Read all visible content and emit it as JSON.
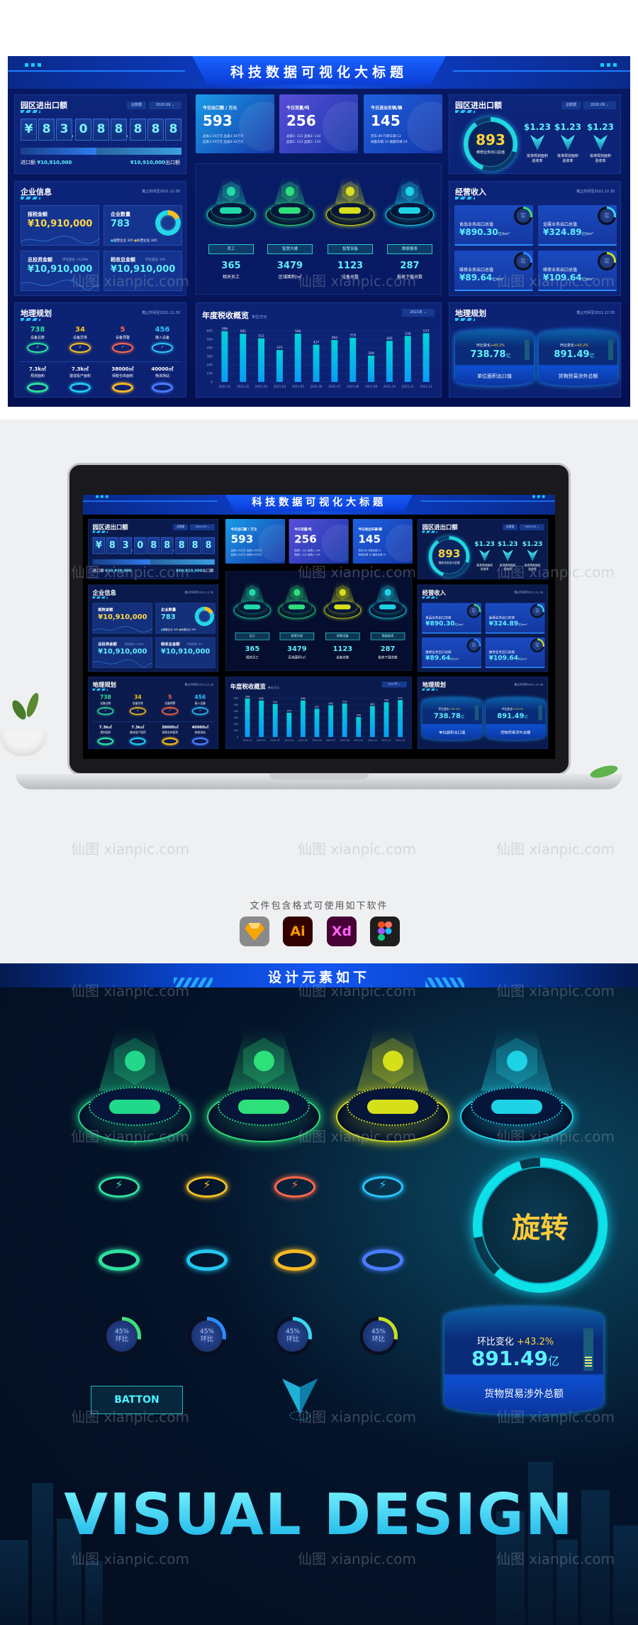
{
  "dashboard": {
    "title": "科技数据可视化大标题",
    "left_trade": {
      "title": "园区进出口额",
      "filter": "总数据",
      "date": "2020.09",
      "digits": [
        "¥",
        "8",
        "3",
        ",",
        "0",
        "8",
        "8",
        ",",
        "8",
        "8",
        "8"
      ],
      "progress": 0.47,
      "import_label": "进口额",
      "import_value": "¥10,910,000",
      "export_value": "¥10,910,000",
      "export_label": "出口额"
    },
    "enterprise": {
      "title": "企业信息",
      "as_of": "截止时间至2021.12.30",
      "tax_label": "报税金额",
      "tax_value": "¥10,910,000",
      "count_label": "企业数量",
      "count_value": "783",
      "state_legend": "国营企业 345",
      "private_legend": "私营企业 345",
      "invest_label": "总投资金额",
      "invest_change": "环比变化 +123%",
      "invest_value": "¥10,910,000",
      "taxrev_label": "税收总金额",
      "taxrev_change": "环比变化 -4%",
      "taxrev_value": "¥10,910,000"
    },
    "geo_left": {
      "title": "地理规划",
      "as_of": "截止时间至2021.12.30",
      "stats": [
        {
          "value": "738",
          "label": "设备总数",
          "color": "#2fe0a0"
        },
        {
          "value": "34",
          "label": "设备异常",
          "color": "#f5c023"
        },
        {
          "value": "5",
          "label": "设备预警",
          "color": "#ff6a4a"
        },
        {
          "value": "456",
          "label": "接入设备",
          "color": "#2bc6ff"
        }
      ],
      "areas": [
        {
          "value": "7.3k㎡",
          "label": "规划面积",
          "color": "#2fe0a0"
        },
        {
          "value": "7.3k㎡",
          "label": "建成投产面积",
          "color": "#22c8f0"
        },
        {
          "value": "38000㎡",
          "label": "保税仓库面积",
          "color": "#f5b923"
        },
        {
          "value": "40000㎡",
          "label": "物流场站",
          "color": "#4a7dff"
        }
      ]
    },
    "cards": [
      {
        "title": "今日出口额 / 万元",
        "value": "593",
        "line1": "品类1:34万元   品类2:34万元",
        "line2": "品类3:34万元   品类4:34万元",
        "color": "#1a9be8"
      },
      {
        "title": "今日货量/吨",
        "value": "256",
        "line1": "品类1: 123   品类2: 134",
        "line2": "品类1: 123   品类2: 134",
        "color": "#5a4fd8"
      },
      {
        "title": "今日进出车辆/辆",
        "value": "145",
        "line1": "货车:89   行政车辆:12",
        "line2": "执勤车辆 10   备勤车辆 24",
        "color": "#1f62e0"
      }
    ],
    "pedestals": [
      {
        "button": "员工",
        "value": "365",
        "label": "相关员工",
        "color": "#22d8a8"
      },
      {
        "button": "智慧大楼",
        "value": "3479",
        "label": "区域面积/㎡",
        "color": "#2ee07a"
      },
      {
        "button": "智慧设备",
        "value": "1123",
        "label": "设备总数",
        "color": "#d6e01a"
      },
      {
        "button": "数据报表",
        "value": "287",
        "label": "报表下载总数",
        "color": "#1ed2e6"
      }
    ],
    "chart_panel": {
      "title": "年度税收概览",
      "unit": "单位/万元",
      "year": "2021年"
    },
    "right_trade": {
      "title": "园区进出口额",
      "filter": "总数据",
      "date": "2020.09",
      "ring_value": "893",
      "ring_label": "维修业务出口总值",
      "items": [
        {
          "value": "$1.23",
          "label": "批准规划面积验收率"
        },
        {
          "value": "$1.23",
          "label": "批准规划面积验收率"
        },
        {
          "value": "$1.23",
          "label": "批准规划面积验收率"
        }
      ]
    },
    "revenue": {
      "title": "经营收入",
      "as_of": "截止时间至2021.12.30",
      "items": [
        {
          "label": "食品业务出口总值",
          "value": "¥890.30",
          "unit": "亿/km²",
          "gauge_value": "45%",
          "gauge_label": "环比",
          "color": "#3ee07a"
        },
        {
          "label": "金属业务出口总值",
          "value": "¥324.89",
          "unit": "亿/km²",
          "gauge_value": "45%",
          "gauge_label": "环比",
          "color": "#3ad8f0"
        },
        {
          "label": "维修业务出口总值",
          "value": "¥89.64",
          "unit": "亿/km²",
          "gauge_value": "45%",
          "gauge_label": "环比",
          "color": "#2a8cff"
        },
        {
          "label": "维修业务出口总值",
          "value": "¥109.64",
          "unit": "亿/km²",
          "gauge_value": "45%",
          "gauge_label": "环比",
          "color": "#c8e020"
        }
      ]
    },
    "geo_right": {
      "title": "地理规划",
      "as_of": "截止时间至2021.12.30",
      "items": [
        {
          "change_label": "环比变化",
          "change": "+43.2%",
          "value": "738.78",
          "unit": "亿",
          "label": "单位面积出口值"
        },
        {
          "change_label": "环比变化",
          "change": "+43.2%",
          "value": "891.49",
          "unit": "亿",
          "label": "货物贸易涉外总额"
        }
      ]
    }
  },
  "chart_data": {
    "type": "bar",
    "title": "年度税收概览",
    "ylabel": "单位/万元",
    "categories": [
      "2021.01",
      "2021.02",
      "2021.03",
      "2021.04",
      "2021.05",
      "2021.06",
      "2021.07",
      "2021.08",
      "2021.09",
      "2021.10",
      "2021.11",
      "2021.12"
    ],
    "values": [
      596,
      565,
      512,
      375,
      566,
      437,
      492,
      519,
      309,
      482,
      539,
      572
    ],
    "yticks": [
      0,
      100,
      200,
      300,
      400,
      500,
      600
    ],
    "ylim": [
      0,
      600
    ],
    "grid": true,
    "data_labels": true,
    "bar_color": [
      "#00d4d8",
      "#0a9cf5"
    ]
  },
  "software": {
    "caption": "文件包含格式可使用如下软件",
    "icons": [
      {
        "name": "sketch-icon",
        "label": ""
      },
      {
        "name": "illustrator-icon",
        "label": "Ai"
      },
      {
        "name": "xd-icon",
        "label": "Xd"
      },
      {
        "name": "figma-icon",
        "label": ""
      }
    ]
  },
  "elements": {
    "title": "设计元素如下",
    "pedestal_colors": [
      "#22d88a",
      "#2ee07a",
      "#d6e01a",
      "#1ed2e6"
    ],
    "ring_colors_row1": [
      "#2fe0a0",
      "#f5c023",
      "#ff6a4a",
      "#2bc6ff"
    ],
    "ring_colors_row2": [
      "#2fe0a0",
      "#22c8f0",
      "#f5b923",
      "#4a7dff"
    ],
    "rotate_label": "旋转",
    "gauges": [
      {
        "value": "45%",
        "label": "环比",
        "color": "#3ee07a"
      },
      {
        "value": "45%",
        "label": "环比",
        "color": "#2a8cff"
      },
      {
        "value": "45%",
        "label": "环比",
        "color": "#3ad8f0"
      },
      {
        "value": "45%",
        "label": "环比",
        "color": "#c8e020"
      }
    ],
    "button_label": "BATTON",
    "cylinder": {
      "change_label": "环比变化",
      "change": "+43.2%",
      "value": "891.49",
      "unit": "亿",
      "label": "货物贸易涉外总额"
    },
    "banner": "VISUAL DESIGN"
  },
  "watermark": "仙图 xianpic.com"
}
